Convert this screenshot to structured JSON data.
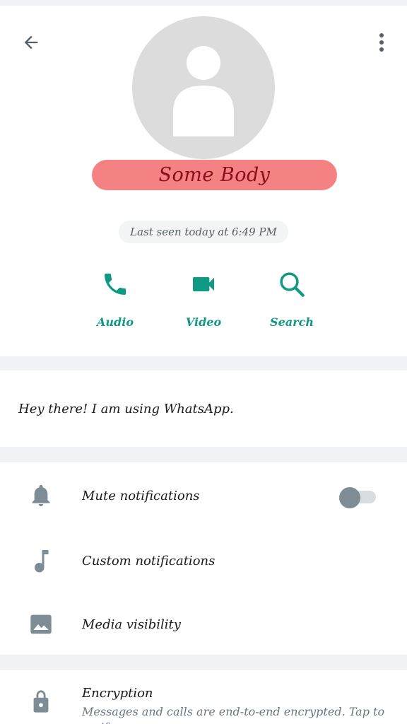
{
  "contact": {
    "name": "Some Body",
    "last_seen": "Last seen today at 6:49 PM",
    "about": "Hey there! I am using WhatsApp."
  },
  "actions": {
    "audio": "Audio",
    "video": "Video",
    "search": "Search"
  },
  "settings": {
    "mute_label": "Mute notifications",
    "mute_enabled": false,
    "custom_label": "Custom notifications",
    "media_label": "Media visibility"
  },
  "encryption": {
    "title": "Encryption",
    "subtitle": "Messages and calls are end-to-end encrypted. Tap to verify."
  },
  "colors": {
    "accent": "#0f9a84",
    "name_pill": "#f58282",
    "name_text": "#8a0f1a",
    "icon_gray": "#7d8c95"
  },
  "icons": {
    "back": "arrow-left-icon",
    "menu": "more-vert-icon",
    "avatar": "person-icon",
    "audio": "phone-icon",
    "video": "videocam-icon",
    "search": "search-icon",
    "mute": "bell-icon",
    "custom": "music-note-icon",
    "media": "image-icon",
    "encryption": "lock-icon"
  }
}
